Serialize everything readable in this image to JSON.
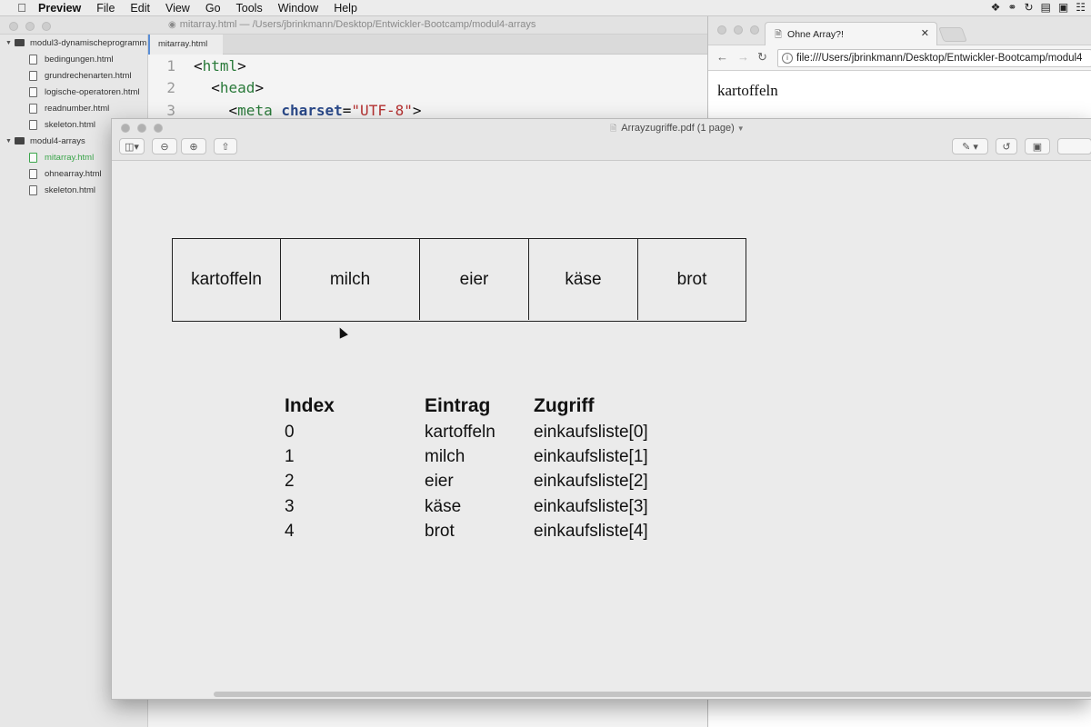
{
  "menubar": {
    "app": "Preview",
    "items": [
      "File",
      "Edit",
      "View",
      "Go",
      "Tools",
      "Window",
      "Help"
    ]
  },
  "editor": {
    "title": "mitarray.html — /Users/jbrinkmann/Desktop/Entwickler-Bootcamp/modul4-arrays",
    "tab": "mitarray.html",
    "folders": [
      {
        "name": "modul3-dynamischeprogramm",
        "files": [
          "bedingungen.html",
          "grundrechenarten.html",
          "logische-operatoren.html",
          "readnumber.html",
          "skeleton.html"
        ]
      },
      {
        "name": "modul4-arrays",
        "files": [
          "mitarray.html",
          "ohnearray.html",
          "skeleton.html"
        ]
      }
    ],
    "active_file": "mitarray.html",
    "code_lines": [
      {
        "num": "1",
        "indent": "",
        "open": "<",
        "tag": "html",
        "close": ">"
      },
      {
        "num": "2",
        "indent": "  ",
        "open": "<",
        "tag": "head",
        "close": ">"
      },
      {
        "num": "3",
        "indent": "    ",
        "open": "<",
        "tag": "meta",
        "attr": "charset",
        "value": "\"UTF-8\"",
        "close": ">"
      }
    ]
  },
  "browser": {
    "tab_title": "Ohne Array?!",
    "url": "file:///Users/jbrinkmann/Desktop/Entwickler-Bootcamp/modul4",
    "page_text": "kartoffeln"
  },
  "preview": {
    "title": "Arrayzugriffe.pdf (1 page)",
    "cells": [
      "kartoffeln",
      "milch",
      "eier",
      "käse",
      "brot"
    ],
    "table": {
      "headers": [
        "Index",
        "Eintrag",
        "Zugriff"
      ],
      "rows": [
        [
          "0",
          "kartoffeln",
          "einkaufsliste[0]"
        ],
        [
          "1",
          "milch",
          "einkaufsliste[1]"
        ],
        [
          "2",
          "eier",
          "einkaufsliste[2]"
        ],
        [
          "3",
          "käse",
          "einkaufsliste[3]"
        ],
        [
          "4",
          "brot",
          "einkaufsliste[4]"
        ]
      ]
    }
  }
}
